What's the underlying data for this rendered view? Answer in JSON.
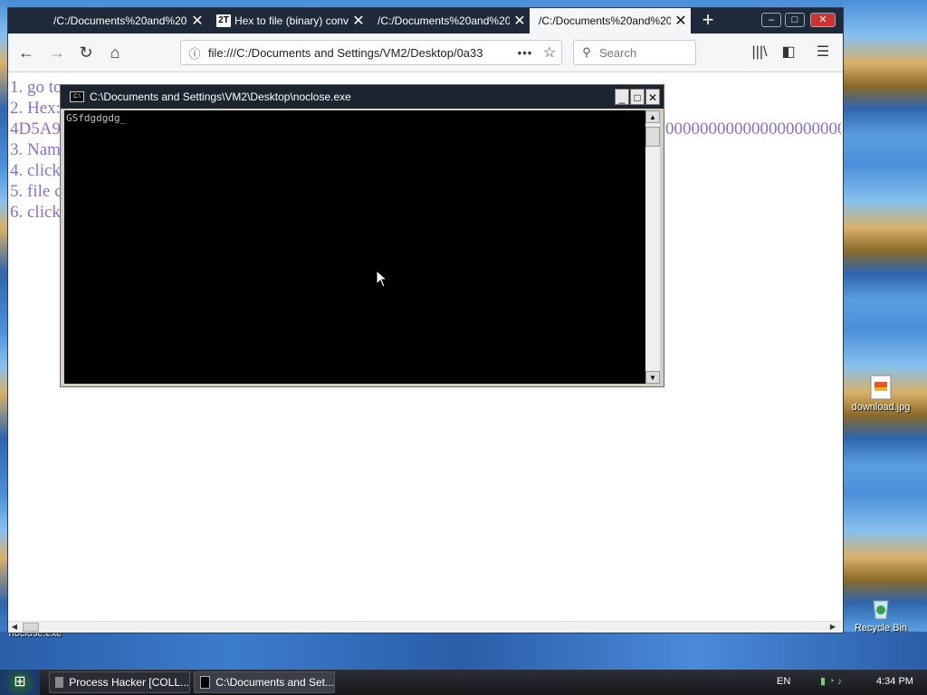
{
  "browser": {
    "tabs": [
      {
        "title": "/C:/Documents%20and%20S",
        "active": false
      },
      {
        "title": "Hex to file (binary) conv",
        "favicon": "2T",
        "active": false
      },
      {
        "title": "/C:/Documents%20and%20S",
        "active": false
      },
      {
        "title": "/C:/Documents%20and%20S",
        "active": true
      }
    ],
    "url": "file:///C:/Documents and Settings/VM2/Desktop/0a33",
    "search_placeholder": "Search",
    "content": {
      "step1": "1. go to",
      "step2": "2. Hex:",
      "hex_start": "4D5A9",
      "hex_end": "0000000000000000000000",
      "step3": "3. Nam",
      "step4": "4. click",
      "step5": "5. file c",
      "step6": "6. click"
    }
  },
  "console": {
    "title": "C:\\Documents and Settings\\VM2\\Desktop\\noclose.exe",
    "icon_label": "C:\\",
    "text": "GSfdgdgdg_"
  },
  "desktop": {
    "icons": [
      {
        "label": "download.jpg"
      },
      {
        "label": "Recycle Bin"
      },
      {
        "label": "noclose.exe"
      }
    ]
  },
  "taskbar": {
    "items": [
      {
        "label": "Process Hacker [COLL..."
      },
      {
        "label": "C:\\Documents and Set..."
      }
    ],
    "language": "EN",
    "clock": "4:34 PM"
  },
  "colors": {
    "content_text": "#8b6fcf",
    "tabbar_bg": "#1e2a3a",
    "console_bg": "#000000"
  }
}
